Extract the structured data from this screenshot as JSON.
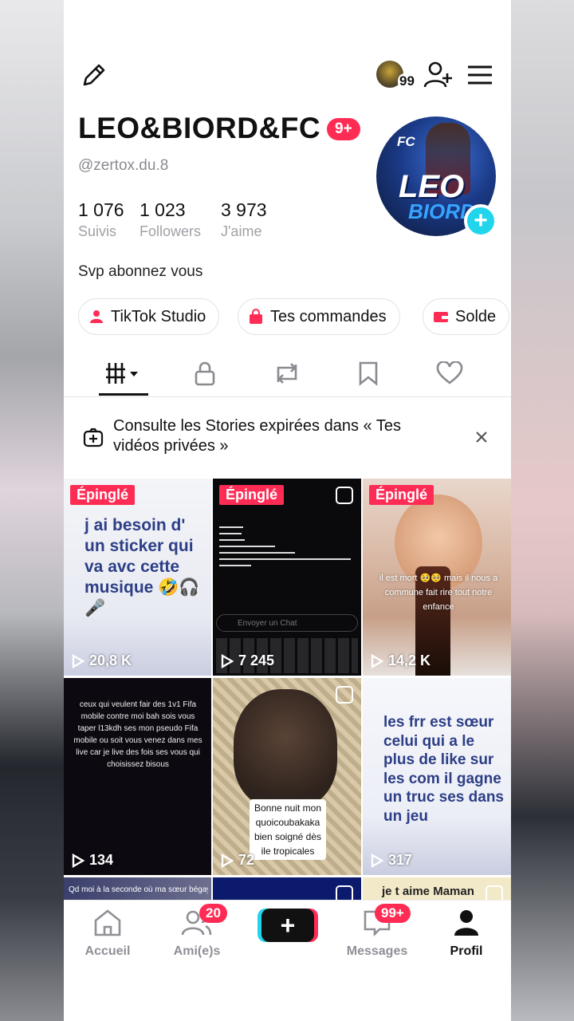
{
  "profile": {
    "display_name": "LEO&BIORD&FC",
    "notif_badge": "9+",
    "handle": "@zertox.du.8",
    "avatar_lines": {
      "fc": "FC",
      "leo": "LEO",
      "biord": "BIORD"
    },
    "header_avatar_count": "99",
    "stats": [
      {
        "value": "1 076",
        "label": "Suivis"
      },
      {
        "value": "1 023",
        "label": "Followers"
      },
      {
        "value": "3 973",
        "label": "J'aime"
      }
    ],
    "bio": "Svp abonnez vous"
  },
  "pills": [
    {
      "label": "TikTok Studio",
      "icon": "studio-icon",
      "color": "#fe2c55"
    },
    {
      "label": "Tes commandes",
      "icon": "shop-icon",
      "color": "#fe2c55"
    },
    {
      "label": "Solde",
      "icon": "wallet-icon",
      "color": "#fe2c55"
    }
  ],
  "tabs": [
    "videos-grid-icon",
    "lock-icon",
    "repost-icon",
    "bookmark-icon",
    "heart-icon"
  ],
  "notice": {
    "text": "Consulte les Stories expirées dans « Tes vidéos privées »"
  },
  "videos": [
    {
      "pinned": "Épinglé",
      "views": "20,8 K",
      "caption": "j ai besoin d' un sticker qui va avc cette musique 🤣🎧🎤"
    },
    {
      "pinned": "Épinglé",
      "views": "7 245",
      "caption": "Envoyer un Chat"
    },
    {
      "pinned": "Épinglé",
      "views": "14,2 K",
      "caption": "il est mort 🥺🥺 mais il nous a commune fait rire tout notre enfance"
    },
    {
      "pinned": "",
      "views": "134",
      "caption": "ceux qui veulent fair des 1v1 Fifa mobile contre moi bah sois vous taper l13kdh ses mon pseudo Fifa mobile ou soit vous venez dans mes live car je live des fois ses vous qui choisissez bisous"
    },
    {
      "pinned": "",
      "views": "72",
      "caption": "Bonne nuit mon quoicoubakaka bien soigné dès ile tropicales"
    },
    {
      "pinned": "",
      "views": "317",
      "caption": "les frr est sœur celui qui a le plus de like sur les com il gagne un truc ses dans un jeu"
    },
    {
      "pinned": "",
      "views": "",
      "caption": "Qd moi à la seconde où ma sœur bégaye"
    },
    {
      "pinned": "",
      "views": "",
      "caption": ""
    },
    {
      "pinned": "",
      "views": "",
      "caption": "je t aime Maman"
    }
  ],
  "nav": {
    "home": "Accueil",
    "friends": "Ami(e)s",
    "friends_badge": "20",
    "create": "+",
    "messages": "Messages",
    "messages_badge": "99+",
    "profile": "Profil"
  },
  "colors": {
    "accent": "#fe2c55",
    "cyan": "#20d5ec",
    "text": "#111111",
    "muted": "#8a8b91"
  }
}
